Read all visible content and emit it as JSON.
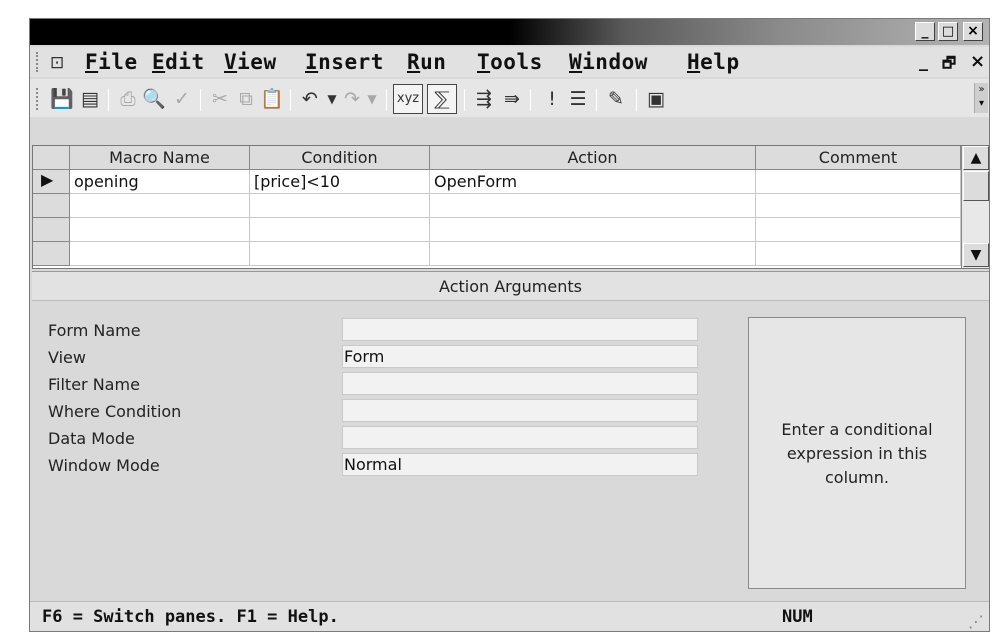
{
  "menu": {
    "items": [
      {
        "ul": "F",
        "rest": "ile"
      },
      {
        "ul": "E",
        "rest": "dit"
      },
      {
        "ul": "V",
        "rest": "iew"
      },
      {
        "ul": "I",
        "rest": "nsert"
      },
      {
        "ul": "R",
        "rest": "un"
      },
      {
        "ul": "T",
        "rest": "ools"
      },
      {
        "ul": "W",
        "rest": "indow"
      },
      {
        "ul": "H",
        "rest": "elp"
      }
    ]
  },
  "caption_buttons": {
    "minimize": "_",
    "maximize": "□",
    "close": "×"
  },
  "mdi_buttons": {
    "minimize": "_",
    "restore": "ₔ",
    "close": "×"
  },
  "toolbar": {
    "icons": [
      "save-icon",
      "table-view-icon",
      "print-icon",
      "print-preview-icon",
      "spelling-icon",
      "cut-icon",
      "copy-icon",
      "paste-icon",
      "undo-icon",
      "dropdown-icon",
      "redo-icon",
      "dropdown-icon",
      "macro-names-icon",
      "conditions-icon",
      "insert-rows-icon",
      "delete-rows-icon",
      "run-icon",
      "build-icon",
      "database-window-icon",
      "new-object-icon",
      "more-icon"
    ]
  },
  "grid": {
    "columns": [
      "Macro Name",
      "Condition",
      "Action",
      "Comment"
    ],
    "rows": [
      {
        "macro_name": "opening",
        "condition": "[price]<10",
        "action": "OpenForm",
        "comment": ""
      },
      {
        "macro_name": "",
        "condition": "",
        "action": "",
        "comment": ""
      },
      {
        "macro_name": "",
        "condition": "",
        "action": "",
        "comment": ""
      },
      {
        "macro_name": "",
        "condition": "",
        "action": "",
        "comment": ""
      }
    ]
  },
  "action_arguments": {
    "title": "Action Arguments",
    "fields": [
      {
        "label": "Form Name",
        "value": ""
      },
      {
        "label": "View",
        "value": "Form"
      },
      {
        "label": "Filter Name",
        "value": ""
      },
      {
        "label": "Where Condition",
        "value": ""
      },
      {
        "label": "Data Mode",
        "value": ""
      },
      {
        "label": "Window Mode",
        "value": "Normal"
      }
    ],
    "hint": "Enter a conditional expression in this column."
  },
  "status": {
    "left": "F6 = Switch panes.  F1 = Help.",
    "right": "NUM"
  }
}
